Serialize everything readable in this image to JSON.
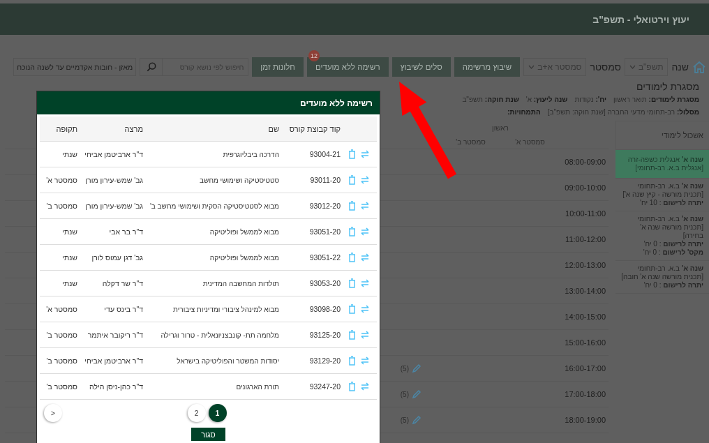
{
  "header": {
    "title": "יעוץ וירטואלי - תשפ\"ב"
  },
  "toolbar": {
    "year": {
      "label": "שנה",
      "value": "תשפ\"ב"
    },
    "semester": {
      "label": "סמסטר",
      "value": "סמסטר א+ב"
    },
    "buttons": [
      {
        "label": "שיבוץ מרשימה"
      },
      {
        "label": "סלים לשיבוץ"
      },
      {
        "label": "רשימה ללא מועדים",
        "badge": "12"
      },
      {
        "label": "חלונות זמן"
      }
    ],
    "search": {
      "placeholder": "חיפוש לפי נושא קורס"
    },
    "balance": {
      "label": "מאזן - חובות אקדמיים עד לשנה הנוכח"
    }
  },
  "info": {
    "title": "מסגרת לימודים",
    "lines": [
      [
        {
          "label": "מסגרת לימודים:",
          "value": "תואר ראשון"
        },
        {
          "label": "יח':",
          "value": "נקודות"
        },
        {
          "label": "שנה ליעוץ:",
          "value": "א'"
        },
        {
          "label": "שנת חוקה:",
          "value": "תשפ\"ב"
        }
      ],
      [
        {
          "label": "מסלול:",
          "value": "רב-תחומי מדעי החברה [שנת חוקה: תשפ\"ב]"
        },
        {
          "label": "התמחויות:"
        }
      ]
    ]
  },
  "sidebar": {
    "title": "אשכול לימודי",
    "items": [
      {
        "selected": true,
        "lines": [
          "**שנה א'** אנגלית כשפה-זרה",
          "[אנגלית ב.א. רב-תחומי]"
        ]
      },
      {
        "selected": false,
        "lines": [
          "**שנה א'** ב.א. רב-תחומי",
          "[תכנית מורשה - קיץ שנה א']",
          "**יתרה לרישום** : 10 יח'"
        ]
      },
      {
        "selected": false,
        "lines": [
          "**שנה א'** ב.א. רב-תחומי",
          "[תכנית מורשה שנה א' בחירה]",
          "**יתרה לרישום** : 0 יח'",
          "**מקס' לרישום** : 0 יח'"
        ]
      },
      {
        "selected": false,
        "lines": [
          "**שנה א'** ב.א. רב-תחומי",
          "[תכנית מורשה שנה א' חובה]",
          "**יתרה לרישום** : 0 יח'"
        ]
      }
    ]
  },
  "schedule": {
    "day": "ראשון",
    "columns": [
      "סמסטר א'",
      "סמסטר ב'"
    ],
    "rows": [
      {
        "time": "08:00-09:00"
      },
      {
        "time": "09:00-10:00"
      },
      {
        "time": "10:00-11:00"
      },
      {
        "time": "11:00-12:00"
      },
      {
        "time": "12:00-13:00"
      },
      {
        "time": "13:00-14:00"
      },
      {
        "time": "14:00-15:00"
      },
      {
        "time": "15:00-16:00"
      },
      {
        "time": "16:00-17:00",
        "column_3": {
          "count": "(5)"
        }
      },
      {
        "time": "17:00-18:00",
        "column_3": {
          "count": "(5)"
        }
      },
      {
        "time": "18:00-19:00",
        "column_3": {
          "count": "(5)"
        }
      }
    ]
  },
  "modal": {
    "title": "רשימה ללא מועדים",
    "columns": [
      "קוד קבוצת קורס",
      "שם",
      "מרצה",
      "תקופה"
    ],
    "rows": [
      {
        "code": "93004-21",
        "name": "הדרכה ביבליוגרפית",
        "lecturer": "ד\"ר ארביטמן אביחי",
        "period": "שנתי"
      },
      {
        "code": "93011-20",
        "name": "סטטיסטיקה ושימושי מחשב",
        "lecturer": "גב' שמש-עירון מורן",
        "period": "סמסטר א'"
      },
      {
        "code": "93012-20",
        "name": "מבוא לסטטיסטיקה הסקית ושימושי מחשב ב'",
        "lecturer": "גב' שמש-עירון מורן",
        "period": "סמסטר ב'"
      },
      {
        "code": "93051-20",
        "name": "מבוא לממשל ופוליטיקה",
        "lecturer": "ד\"ר בר אבי",
        "period": "שנתי"
      },
      {
        "code": "93051-22",
        "name": "מבוא לממשל ופוליטיקה",
        "lecturer": "גב' דגן עמוס לורן",
        "period": "שנתי"
      },
      {
        "code": "93053-20",
        "name": "תולדות המחשבה המדינית",
        "lecturer": "ד\"ר שר דקלה",
        "period": "שנתי"
      },
      {
        "code": "93098-20",
        "name": "מבוא למינהל ציבורי ומדיניות ציבורית",
        "lecturer": "ד\"ר בינס עדי",
        "period": "סמסטר א'"
      },
      {
        "code": "93125-20",
        "name": "מלחמה תת- קונבצניונאלית - טרור וגרילה",
        "lecturer": "ד\"ר ריקובר איתמר",
        "period": "סמסטר ב'"
      },
      {
        "code": "93129-20",
        "name": "יסודות המשטר והפוליטיקה בישראל",
        "lecturer": "ד\"ר ארביטמן אביחי",
        "period": "סמסטר ב'"
      },
      {
        "code": "93247-20",
        "name": "תורת הארגונים",
        "lecturer": "ד\"ר כהן-ניסן הילה",
        "period": "סמסטר ב'"
      }
    ],
    "pages": [
      {
        "label": "1",
        "selected": true
      },
      {
        "label": "2",
        "selected": false
      }
    ],
    "prev": "<",
    "close": "סגור"
  }
}
